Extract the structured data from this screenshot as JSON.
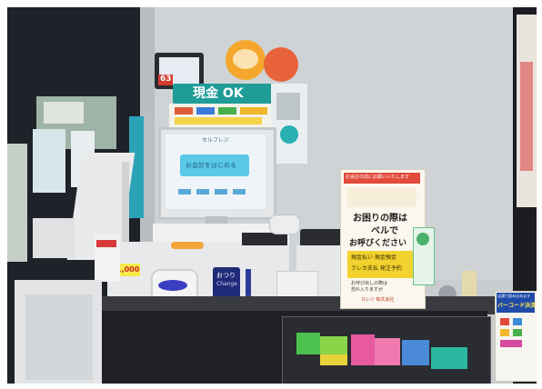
{
  "photo": {
    "kind": "self-checkout kiosk in a shop",
    "colors": {
      "wall": "#cfd3d6",
      "dark_panel": "#1a1c22",
      "counter": "#232429",
      "machine": "#e8e9ea",
      "screen": "#7fd4ee",
      "sign_orange": "#e85a2c",
      "sign_yellow": "#f2d22e",
      "cash_banner": "#26b6b0"
    }
  },
  "sign_cash_ok": {
    "text": "現金 OK"
  },
  "sign_number": {
    "text": "63"
  },
  "screen": {
    "header": "セルフレジ",
    "start_button": "お会計をはじめる"
  },
  "bill_slot": {
    "label": "おつり",
    "small": "Change"
  },
  "price_tag": {
    "text": "1,000"
  },
  "counter_sign": {
    "top_banner": "お会計の前にお願いいたします",
    "main_line1": "お困りの際は",
    "main_line2": "ベルで",
    "main_line3": "お呼びください",
    "box_line1": "現金払い 現金預金",
    "box_line2": "クレカ支払 発注予約",
    "bottom_line1": "お呼び出しの際は",
    "bottom_line2": "恐れ入りますが",
    "footer": "Dレジ 株式会社"
  },
  "right_sign": {
    "top": "店頭で読み込めます",
    "title": "バーコード決済"
  }
}
